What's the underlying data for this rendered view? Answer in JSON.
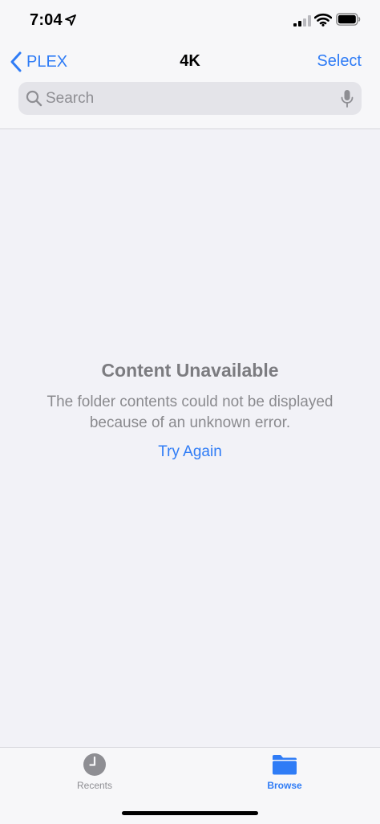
{
  "status_bar": {
    "time": "7:04"
  },
  "nav": {
    "back_label": "PLEX",
    "title": "4K",
    "select_label": "Select"
  },
  "search": {
    "placeholder": "Search",
    "value": ""
  },
  "empty_state": {
    "title": "Content Unavailable",
    "message": "The folder contents could not be displayed because of an unknown error.",
    "action_label": "Try Again"
  },
  "tab_bar": {
    "tabs": [
      {
        "label": "Recents",
        "icon": "clock-icon",
        "selected": false
      },
      {
        "label": "Browse",
        "icon": "folder-icon",
        "selected": true
      }
    ]
  },
  "colors": {
    "accent": "#2f7cf6",
    "background": "#f2f2f7",
    "secondary_text": "#8e8e93"
  }
}
